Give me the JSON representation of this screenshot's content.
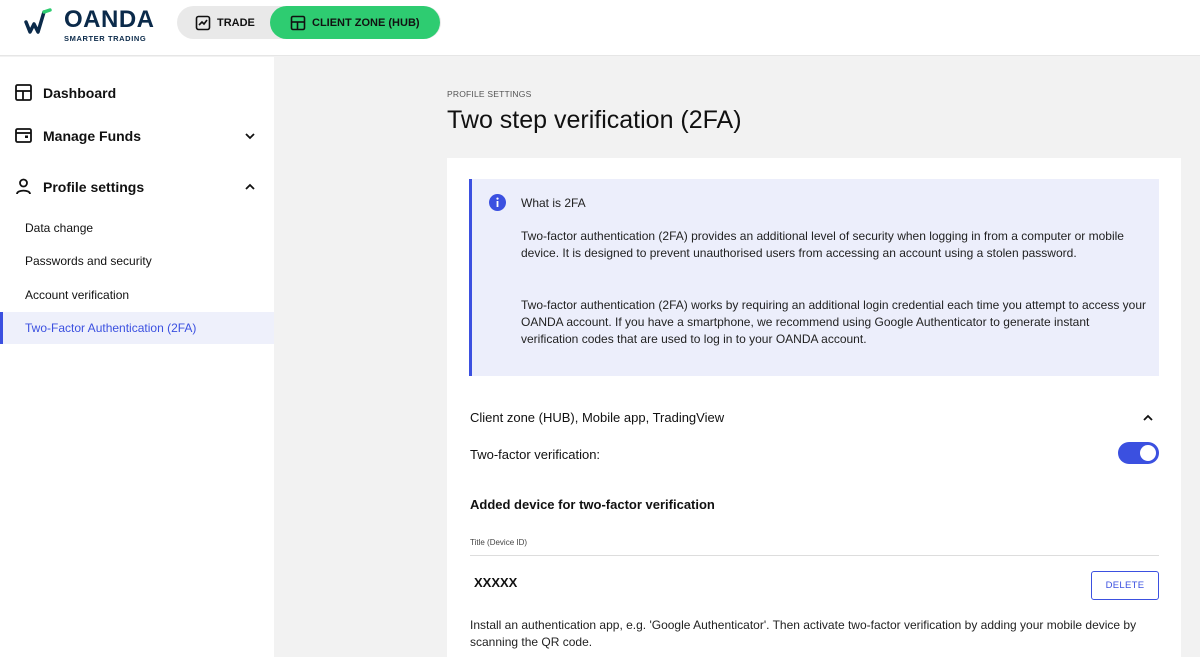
{
  "header": {
    "logo": {
      "name": "OANDA",
      "tagline": "SMARTER TRADING"
    },
    "tabs": [
      {
        "label": "TRADE",
        "icon": "trend-chart-icon",
        "active": false
      },
      {
        "label": "CLIENT ZONE (HUB)",
        "icon": "dashboard-icon",
        "active": true
      }
    ],
    "accent_color": "#2ecc71"
  },
  "sidebar": {
    "items": [
      {
        "label": "Dashboard",
        "icon": "dashboard-icon"
      },
      {
        "label": "Manage Funds",
        "icon": "wallet-icon",
        "expanded": false
      },
      {
        "label": "Profile settings",
        "icon": "user-icon",
        "expanded": true
      }
    ],
    "subitems": [
      {
        "label": "Data change",
        "active": false
      },
      {
        "label": "Passwords and security",
        "active": false
      },
      {
        "label": "Account verification",
        "active": false
      },
      {
        "label": "Two-Factor Authentication (2FA)",
        "active": true
      }
    ]
  },
  "main": {
    "breadcrumb": "PROFILE SETTINGS",
    "title": "Two step verification (2FA)",
    "info": {
      "icon": "info-icon",
      "title": "What is 2FA",
      "p1": "Two-factor authentication (2FA) provides an additional level of security when logging in from a computer or mobile device. It is designed to prevent unauthorised users from accessing an account using a stolen password.",
      "p2": "Two-factor authentication (2FA) works by requiring an additional login credential each time you attempt to access your OANDA account. If you have a smartphone, we recommend using Google Authenticator to generate instant verification codes that are used to log in to your OANDA account."
    },
    "section": {
      "title": "Client zone (HUB), Mobile app, TradingView",
      "expanded": true,
      "toggle_label": "Two-factor verification:",
      "toggle_on": true
    },
    "devices": {
      "title": "Added device for two-factor verification",
      "column": "Title (Device ID)",
      "rows": [
        {
          "name": "XXXXX",
          "action": "DELETE"
        }
      ]
    },
    "install_text": "Install an authentication app, e.g. 'Google Authenticator'. Then activate two-factor verification by adding your mobile device by scanning the QR code.",
    "accent_color": "#3b50e0"
  }
}
